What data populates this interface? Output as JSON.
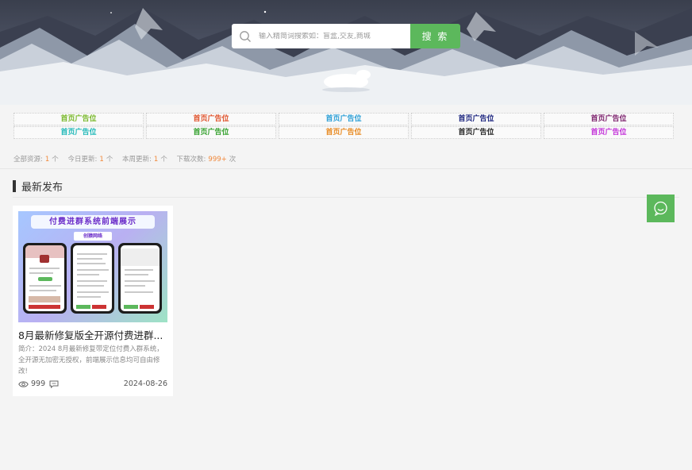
{
  "search": {
    "placeholder": "输入精简词搜索如：盲盒,交友,商城",
    "button_label": "搜 索"
  },
  "ads": [
    {
      "label": "首页广告位",
      "color": "#79b82a"
    },
    {
      "label": "首页广告位",
      "color": "#e0542d"
    },
    {
      "label": "首页广告位",
      "color": "#2a9fd6"
    },
    {
      "label": "首页广告位",
      "color": "#1a237e"
    },
    {
      "label": "首页广告位",
      "color": "#7b1f6b"
    },
    {
      "label": "首页广告位",
      "color": "#1fb8b8"
    },
    {
      "label": "首页广告位",
      "color": "#33a02c"
    },
    {
      "label": "首页广告位",
      "color": "#e8891f"
    },
    {
      "label": "首页广告位",
      "color": "#222222"
    },
    {
      "label": "首页广告位",
      "color": "#c22fd8"
    }
  ],
  "stats": {
    "total_label": "全部资源:",
    "total_value": "1",
    "total_unit": "个",
    "today_label": "今日更新:",
    "today_value": "1",
    "today_unit": "个",
    "week_label": "本周更新:",
    "week_value": "1",
    "week_unit": "个",
    "downloads_label": "下载次数:",
    "downloads_value": "999+",
    "downloads_unit": "次"
  },
  "section": {
    "title": "最新发布"
  },
  "cards": [
    {
      "thumb_title": "付费进群系统前端展示",
      "thumb_subtitle": "创猿网络",
      "title": "8月最新修复版全开源付费进群...",
      "desc": "简介：2024 8月最新修复带定位付费入群系统，全开源无加密无授权，前端展示信息均可自由修改!",
      "views": "999",
      "date": "2024-08-26"
    }
  ],
  "colors": {
    "accent": "#5cb85c",
    "stat_number": "#f0883a"
  },
  "icons": {
    "search": "search-icon",
    "views": "eye-icon",
    "comments": "comment-icon",
    "float": "chat-bubble-icon"
  }
}
